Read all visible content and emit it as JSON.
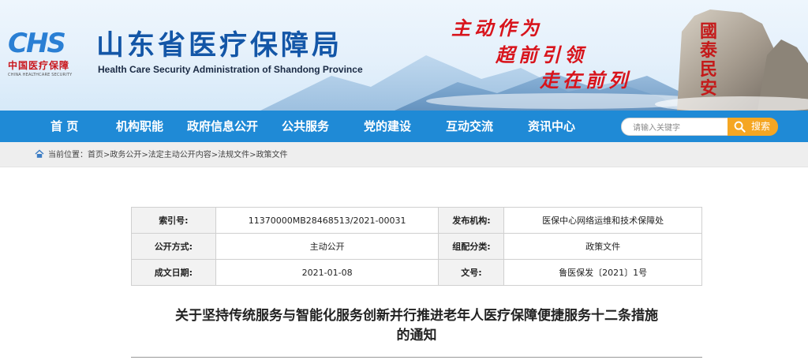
{
  "header": {
    "logo_mark": "CHS",
    "logo_cn": "中国医疗保障",
    "logo_en": "CHINA HEALTHCARE SECURITY",
    "title": "山东省医疗保障局",
    "subtitle": "Health Care Security Administration of Shandong Province",
    "slogans": [
      "主动作为",
      "超前引领",
      "走在前列"
    ],
    "rock_inscription": "國泰民安"
  },
  "nav": {
    "items": [
      "首  页",
      "机构职能",
      "政府信息公开",
      "公共服务",
      "党的建设",
      "互动交流",
      "资讯中心"
    ]
  },
  "search": {
    "placeholder": "请输入关键字",
    "button_label": "搜索"
  },
  "breadcrumb": {
    "prefix": "当前位置：",
    "items": [
      "首页",
      "政务公开",
      "法定主动公开内容",
      "法规文件",
      "政策文件"
    ],
    "separator": ">"
  },
  "meta": {
    "rows": [
      {
        "k1": "索引号:",
        "v1": "11370000MB28468513/2021-00031",
        "k2": "发布机构:",
        "v2": "医保中心网络运维和技术保障处"
      },
      {
        "k1": "公开方式:",
        "v1": "主动公开",
        "k2": "组配分类:",
        "v2": "政策文件"
      },
      {
        "k1": "成文日期:",
        "v1": "2021-01-08",
        "k2": "文号:",
        "v2": "鲁医保发〔2021〕1号"
      }
    ]
  },
  "article": {
    "title_line1": "关于坚持传统服务与智能化服务创新并行推进老年人医疗保障便捷服务十二条措施",
    "title_line2": "的通知"
  },
  "colors": {
    "nav_bg": "#1f8ad6",
    "title_blue": "#1356a7",
    "slogan_red": "#d8141c",
    "search_btn": "#f5a623"
  }
}
